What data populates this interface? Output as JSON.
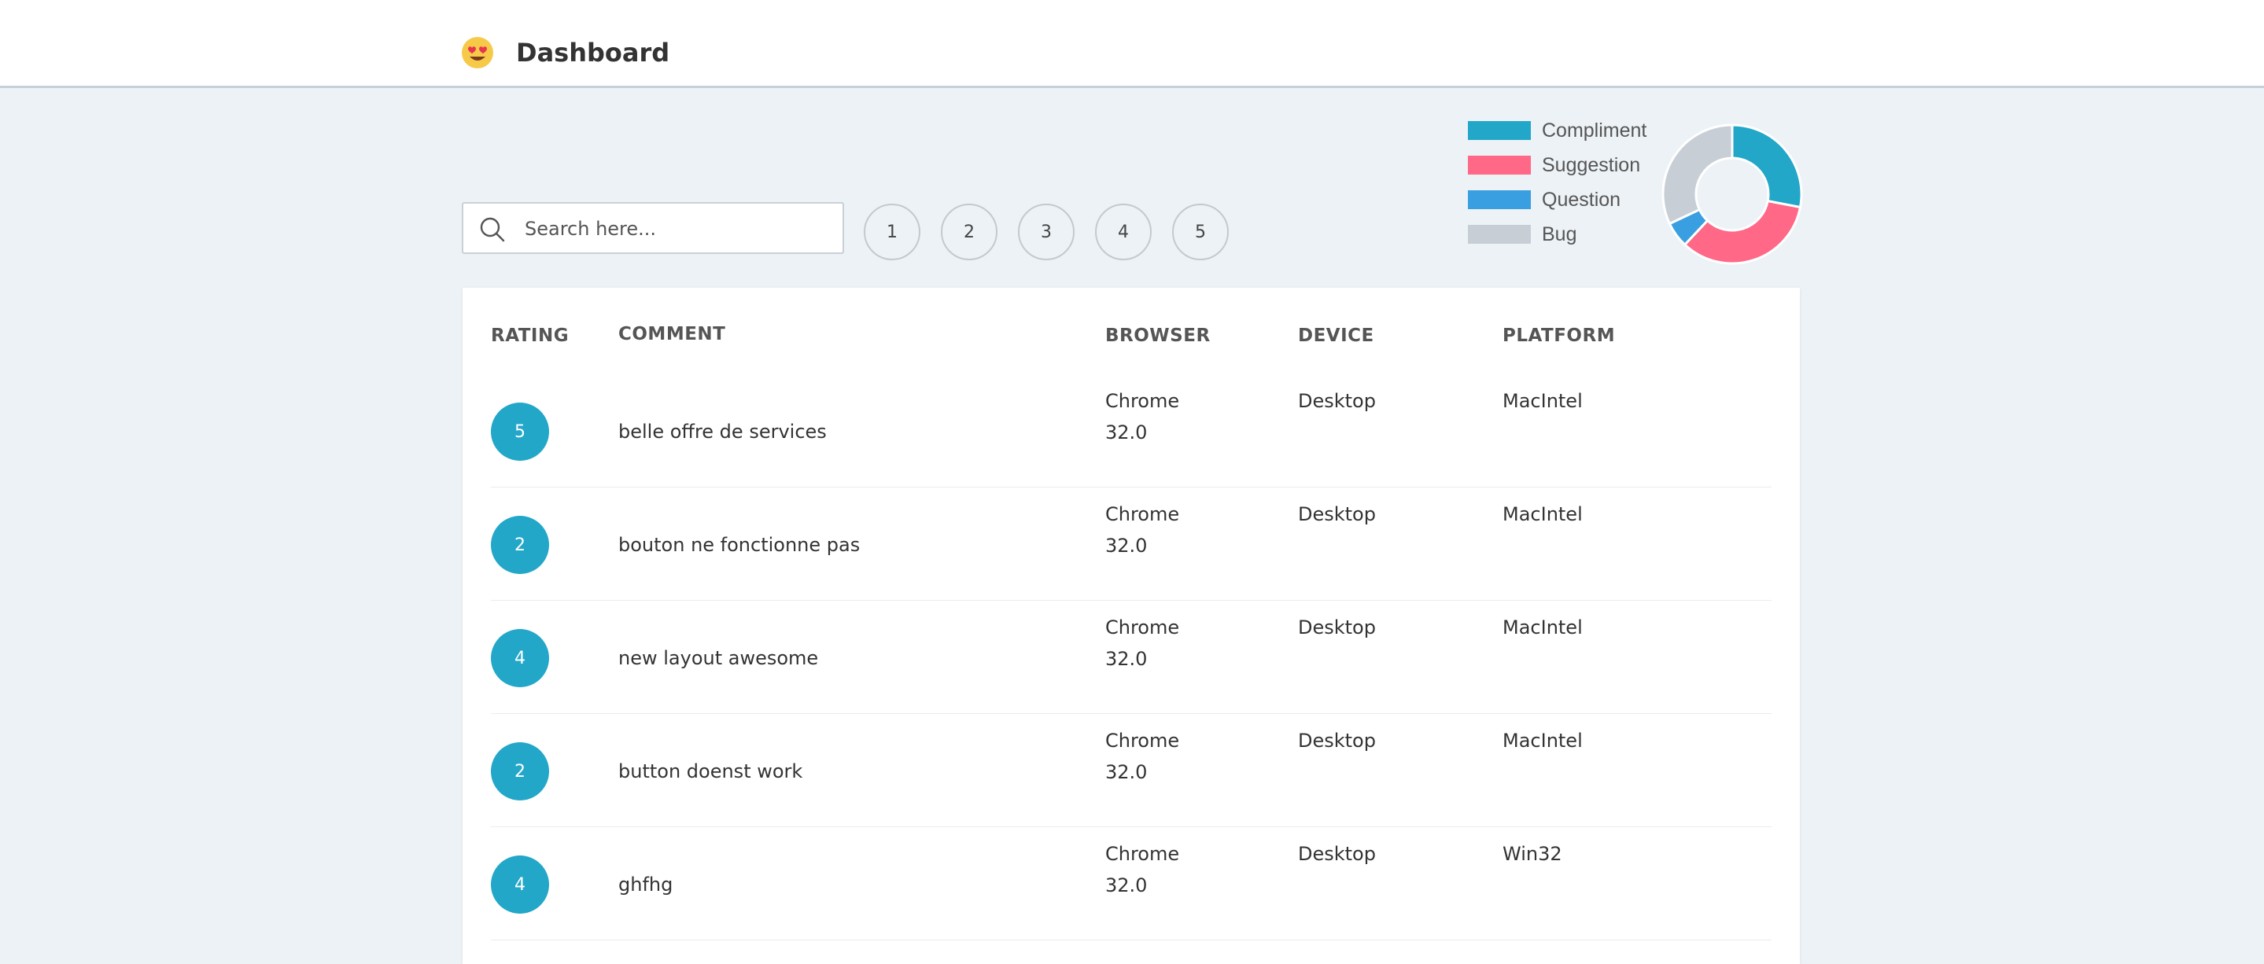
{
  "header": {
    "title": "Dashboard",
    "logo_icon": "heart-eyes-emoji-icon"
  },
  "search": {
    "placeholder": "Search here...",
    "value": ""
  },
  "pagination": [
    "1",
    "2",
    "3",
    "4",
    "5"
  ],
  "legend": [
    {
      "label": "Compliment",
      "color": "#22a7c9"
    },
    {
      "label": "Suggestion",
      "color": "#ff6886"
    },
    {
      "label": "Question",
      "color": "#3a9fe0"
    },
    {
      "label": "Bug",
      "color": "#c7ced6"
    }
  ],
  "chart_data": {
    "type": "pie",
    "donut": true,
    "categories": [
      "Compliment",
      "Suggestion",
      "Question",
      "Bug"
    ],
    "values": [
      28,
      34,
      6,
      32
    ],
    "colors": [
      "#22a7c9",
      "#ff6886",
      "#3a9fe0",
      "#c7ced6"
    ]
  },
  "table": {
    "headers": {
      "rating": "RATING",
      "comment": "COMMENT",
      "browser": "BROWSER",
      "device": "DEVICE",
      "platform": "PLATFORM"
    },
    "rows": [
      {
        "rating": "5",
        "comment": "belle offre de services",
        "browser_name": "Chrome",
        "browser_version": "32.0",
        "device": "Desktop",
        "platform": "MacIntel"
      },
      {
        "rating": "2",
        "comment": "bouton ne fonctionne pas",
        "browser_name": "Chrome",
        "browser_version": "32.0",
        "device": "Desktop",
        "platform": "MacIntel"
      },
      {
        "rating": "4",
        "comment": "new layout awesome",
        "browser_name": "Chrome",
        "browser_version": "32.0",
        "device": "Desktop",
        "platform": "MacIntel"
      },
      {
        "rating": "2",
        "comment": "button doenst work",
        "browser_name": "Chrome",
        "browser_version": "32.0",
        "device": "Desktop",
        "platform": "MacIntel"
      },
      {
        "rating": "4",
        "comment": "ghfhg",
        "browser_name": "Chrome",
        "browser_version": "32.0",
        "device": "Desktop",
        "platform": "Win32"
      }
    ]
  }
}
